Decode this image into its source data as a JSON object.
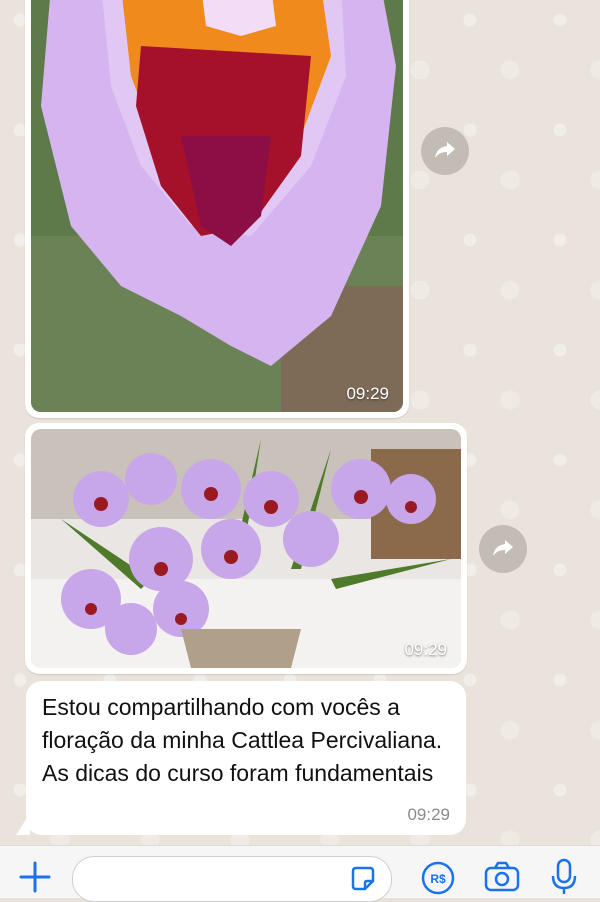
{
  "messages": [
    {
      "type": "image",
      "description_icon": "orchid-closeup-photo",
      "time": "09:29"
    },
    {
      "type": "image",
      "description_icon": "orchid-bouquet-photo",
      "time": "09:29"
    },
    {
      "type": "text",
      "text": "Estou compartilhando com vocês a floração da minha Cattlea Percivaliana. As dicas do curso foram fundamentais",
      "time": "09:29"
    }
  ],
  "input_bar": {
    "icons": [
      "plus-icon",
      "sticker-icon",
      "payment-icon",
      "camera-icon",
      "microphone-icon"
    ],
    "input_value": ""
  },
  "colors": {
    "accent": "#1a73e8",
    "bubble": "#ffffff",
    "chat_background": "#e9e3db"
  }
}
